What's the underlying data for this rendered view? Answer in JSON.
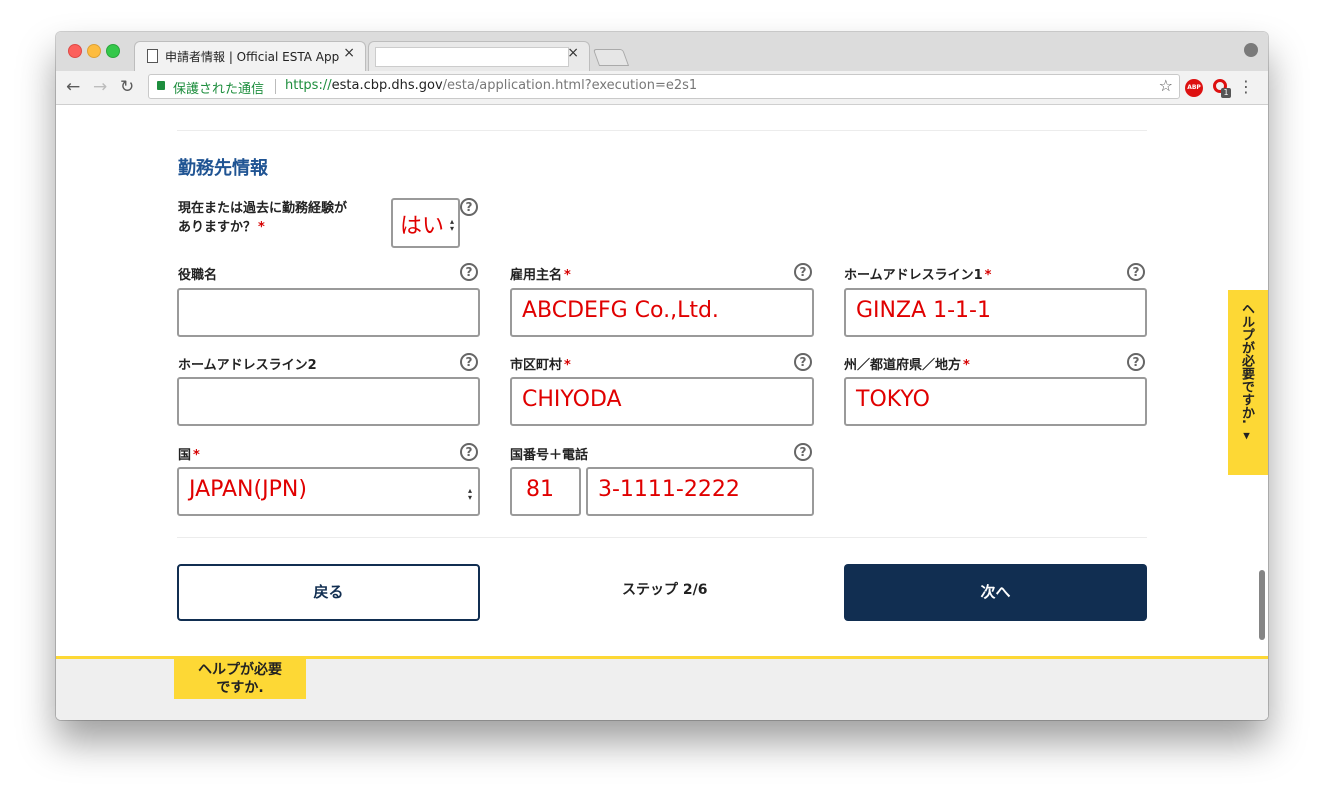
{
  "browser": {
    "tab1_title": "申請者情報 | Official ESTA Appl",
    "tab_close": "×",
    "secure_label": "保護された通信",
    "url_scheme": "https://",
    "url_host": "esta.cbp.dhs.gov",
    "url_path": "/esta/application.html?execution=e2s1",
    "abp_label": "ABP",
    "ext_badge": "1"
  },
  "form": {
    "section_title": "勤務先情報",
    "experience_question_line1": "現在または過去に勤務経験が",
    "experience_question_line2": "ありますか？",
    "experience_value": "はい",
    "required_mark": "*",
    "help_glyph": "?",
    "fields": {
      "job_title": {
        "label": "役職名",
        "value": ""
      },
      "employer_name": {
        "label": "雇用主名",
        "value": "ABCDEFG Co.,Ltd."
      },
      "address1": {
        "label": "ホームアドレスライン1",
        "value": "GINZA 1-1-1"
      },
      "address2": {
        "label": "ホームアドレスライン2",
        "value": ""
      },
      "city": {
        "label": "市区町村",
        "value": "CHIYODA"
      },
      "state": {
        "label": "州／都道府県／地方",
        "value": "TOKYO"
      },
      "country": {
        "label": "国",
        "value": "JAPAN(JPN)"
      },
      "phone": {
        "label": "国番号＋電話",
        "country_code": "81",
        "number": "3-1111-2222"
      }
    }
  },
  "nav": {
    "back_label": "戻る",
    "step_text": "ステップ 2/6",
    "next_label": "次へ"
  },
  "help": {
    "side_label": "ヘルプが必要ですか. ▾",
    "footer_line1": "ヘルプが必要",
    "footer_line2": "ですか."
  },
  "colors": {
    "primary_navy": "#112e51",
    "title_blue": "#205493",
    "help_yellow": "#fdd835",
    "required_red": "#d60000",
    "entered_text_red": "#e00000"
  }
}
